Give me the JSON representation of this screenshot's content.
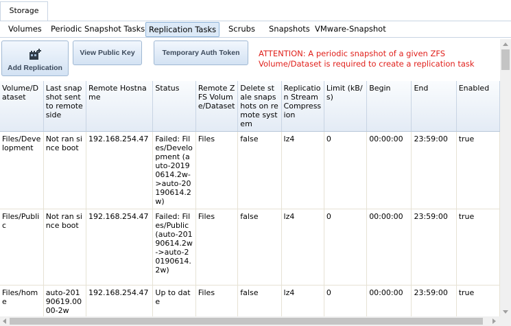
{
  "top_tabs": [
    {
      "label": "Storage"
    }
  ],
  "sub_tabs": [
    {
      "label": "Volumes"
    },
    {
      "label": "Periodic Snapshot Tasks"
    },
    {
      "label": "Replication Tasks"
    },
    {
      "label": "Scrubs"
    },
    {
      "label": "Snapshots"
    },
    {
      "label": "VMware-Snapshot"
    }
  ],
  "toolbar": {
    "add_replication_label": "Add Replication",
    "add_replication_icon": "add-replication-icon",
    "view_public_key_label": "View Public Key",
    "temp_auth_token_label": "Temporary Auth Token",
    "attention_text": "ATTENTION: A periodic snapshot of a given ZFS Volume/Dataset is required to create a replication task",
    "attention_color": "#e0201b"
  },
  "table": {
    "columns": [
      "Volume/Dataset",
      "Last snapshot sent to remote side",
      "Remote Hostname",
      "Status",
      "Remote ZFS Volume/Dataset",
      "Delete stale snapshots on remote system",
      "Replication Stream Compression",
      "Limit (kB/s)",
      "Begin",
      "End",
      "Enabled"
    ],
    "rows": [
      [
        "Files/Development",
        "Not ran since boot",
        "192.168.254.47",
        "Failed: Files/Development (auto-20190614.2w->auto-20190614.2w)",
        "Files",
        "false",
        "lz4",
        "0",
        "00:00:00",
        "23:59:00",
        "true"
      ],
      [
        "Files/Public",
        "Not ran since boot",
        "192.168.254.47",
        "Failed: Files/Public (auto-20190614.2w->auto-20190614.2w)",
        "Files",
        "false",
        "lz4",
        "0",
        "00:00:00",
        "23:59:00",
        "true"
      ],
      [
        "Files/home",
        "auto-20190619.0000-2w",
        "192.168.254.47",
        "Up to date",
        "Files",
        "false",
        "lz4",
        "0",
        "00:00:00",
        "23:59:00",
        "true"
      ]
    ]
  },
  "colors": {
    "header_bg": "#e3ebf5",
    "active_tab_bg": "#dce9f7",
    "grid_line": "#e6e2d4"
  }
}
